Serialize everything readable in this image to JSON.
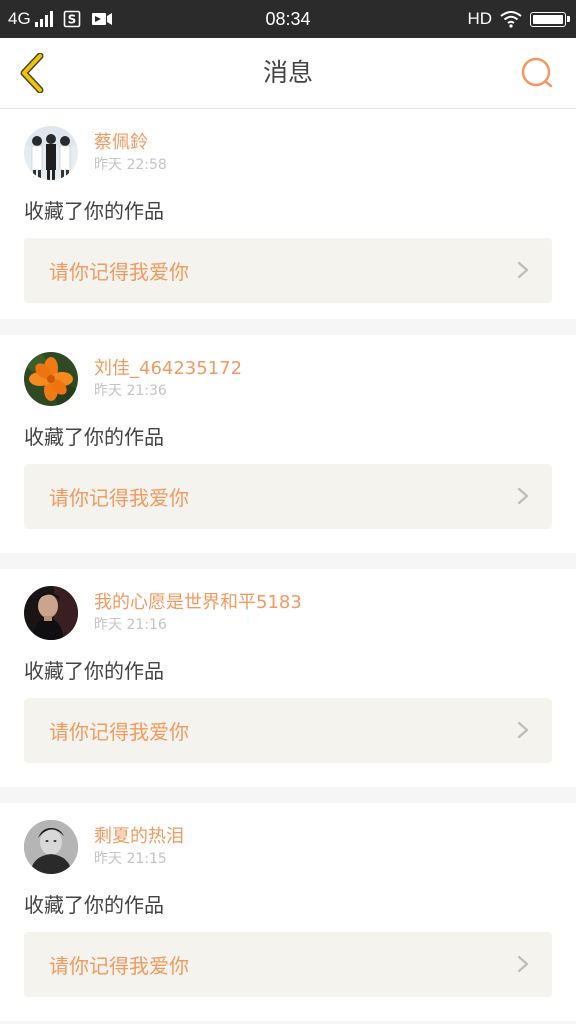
{
  "status_bar": {
    "network": "4G",
    "time": "08:34",
    "hd": "HD"
  },
  "nav": {
    "title": "消息"
  },
  "messages": [
    {
      "name": "蔡佩鈴",
      "time": "昨天 22:58",
      "action": "收藏了你的作品",
      "work": "请你记得我爱你"
    },
    {
      "name": "刘佳_464235172",
      "time": "昨天 21:36",
      "action": "收藏了你的作品",
      "work": "请你记得我爱你"
    },
    {
      "name": "我的心愿是世界和平5183",
      "time": "昨天 21:16",
      "action": "收藏了你的作品",
      "work": "请你记得我爱你"
    },
    {
      "name": "剩夏的热泪",
      "time": "昨天 21:15",
      "action": "收藏了你的作品",
      "work": "请你记得我爱你"
    }
  ],
  "colors": {
    "accent": "#f29a60",
    "time_gray": "#c4c4c4",
    "work_box_bg": "#f4f3ee",
    "status_bar_bg": "#2b2b2b",
    "back_arrow": "#f5c400"
  },
  "icons": {
    "back": "chevron-left-icon",
    "search": "search-icon",
    "work_arrow": "chevron-right-icon"
  }
}
